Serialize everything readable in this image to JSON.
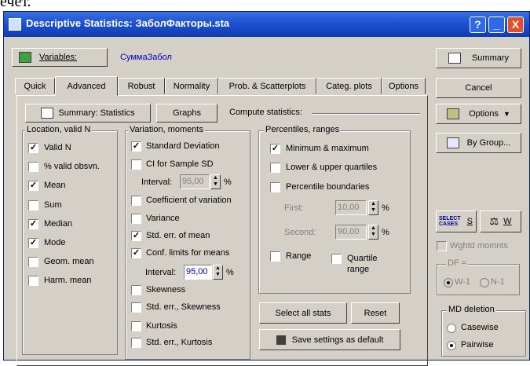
{
  "background_fragment": "ечет.",
  "window": {
    "title": "Descriptive Statistics: ЗаболФакторы.sta",
    "help_label": "?",
    "min_label": "_",
    "close_label": "X"
  },
  "variables": {
    "button_label": "Variables:",
    "value": "СуммаЗабол"
  },
  "tabs": [
    {
      "label": "Quick",
      "active": false
    },
    {
      "label": "Advanced",
      "active": true
    },
    {
      "label": "Robust",
      "active": false
    },
    {
      "label": "Normality",
      "active": false
    },
    {
      "label": "Prob. & Scatterplots",
      "active": false
    },
    {
      "label": "Categ. plots",
      "active": false
    },
    {
      "label": "Options",
      "active": false
    }
  ],
  "toolbar": {
    "summary_label": "Summary: Statistics",
    "graphs_label": "Graphs",
    "compute_label": "Compute statistics:"
  },
  "location": {
    "title": "Location, valid N",
    "items": [
      {
        "label": "Valid N",
        "checked": true
      },
      {
        "label": "% valid obsvn.",
        "checked": false
      },
      {
        "label": "Mean",
        "checked": true
      },
      {
        "label": "Sum",
        "checked": false
      },
      {
        "label": "Median",
        "checked": true
      },
      {
        "label": "Mode",
        "checked": true
      },
      {
        "label": "Geom. mean",
        "checked": false
      },
      {
        "label": "Harm. mean",
        "checked": false
      }
    ]
  },
  "variation": {
    "title": "Variation, moments",
    "std_dev": {
      "label": "Standard Deviation",
      "checked": true
    },
    "ci_sd": {
      "label": "CI for Sample SD",
      "checked": false
    },
    "interval1_label": "Interval:",
    "interval1_value": "95,00",
    "coef_var": {
      "label": "Coefficient of variation",
      "checked": false
    },
    "variance": {
      "label": "Variance",
      "checked": false
    },
    "std_err_mean": {
      "label": "Std. err. of mean",
      "checked": true
    },
    "conf_limits": {
      "label": "Conf. limits for means",
      "checked": true
    },
    "interval2_label": "Interval:",
    "interval2_value": "95,00",
    "skewness": {
      "label": "Skewness",
      "checked": false
    },
    "std_err_skew": {
      "label": "Std. err., Skewness",
      "checked": false
    },
    "kurtosis": {
      "label": "Kurtosis",
      "checked": false
    },
    "std_err_kurt": {
      "label": "Std. err., Kurtosis",
      "checked": false
    },
    "percent_sign": "%"
  },
  "percentiles": {
    "title": "Percentiles, ranges",
    "minmax": {
      "label": "Minimum & maximum",
      "checked": true
    },
    "quartiles": {
      "label": "Lower & upper quartiles",
      "checked": false
    },
    "boundaries": {
      "label": "Percentile boundaries",
      "checked": false
    },
    "first_label": "First:",
    "first_value": "10,00",
    "second_label": "Second:",
    "second_value": "90,00",
    "range": {
      "label": "Range",
      "checked": false
    },
    "quartile_range": {
      "label_line1": "Quartile",
      "label_line2": "range",
      "checked": false
    }
  },
  "bottom_buttons": {
    "select_all": "Select all stats",
    "reset": "Reset",
    "save_settings": "Save settings as default"
  },
  "right": {
    "summary": "Summary",
    "cancel": "Cancel",
    "options": "Options",
    "by_group": "By Group...",
    "select_cases_line1": "SELECT",
    "select_cases_line2": "CASES",
    "s_label": "S",
    "w_label": "W",
    "wghtd": "Wghtd momnts",
    "df_title": "DF =",
    "df_w1": "W-1",
    "df_n1": "N-1",
    "md_title": "MD deletion",
    "casewise": "Casewise",
    "pairwise": "Pairwise",
    "pairwise_selected": true
  },
  "colors": {
    "titlebar": "#1c4fd0",
    "face": "#d4d0c8",
    "value_text": "#0000c0"
  }
}
